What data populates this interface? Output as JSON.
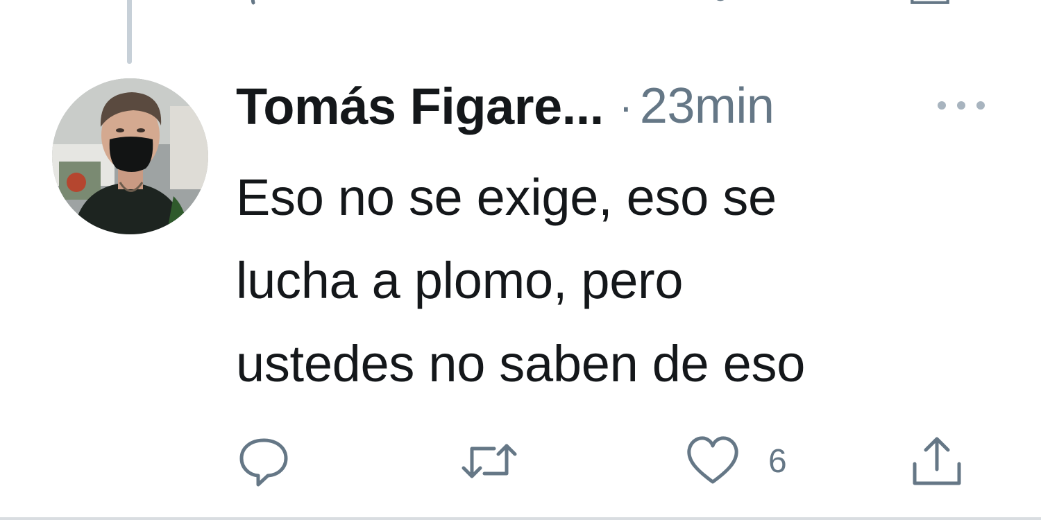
{
  "tweet": {
    "author_name": "Tomás Figare...",
    "separator": "·",
    "time": "23min",
    "text_lines": [
      "Eso no se exige, eso se",
      "lucha a plomo, pero",
      "ustedes no saben de eso"
    ],
    "actions": {
      "reply_icon": "reply-icon",
      "retweet_icon": "retweet-icon",
      "like_icon": "heart-icon",
      "like_count": "6",
      "share_icon": "share-icon"
    },
    "more_icon": "more-options-icon"
  },
  "colors": {
    "text_primary": "#14171a",
    "text_secondary": "#657786",
    "thread_line": "#c7d0d8",
    "divider": "#d9dde1"
  }
}
